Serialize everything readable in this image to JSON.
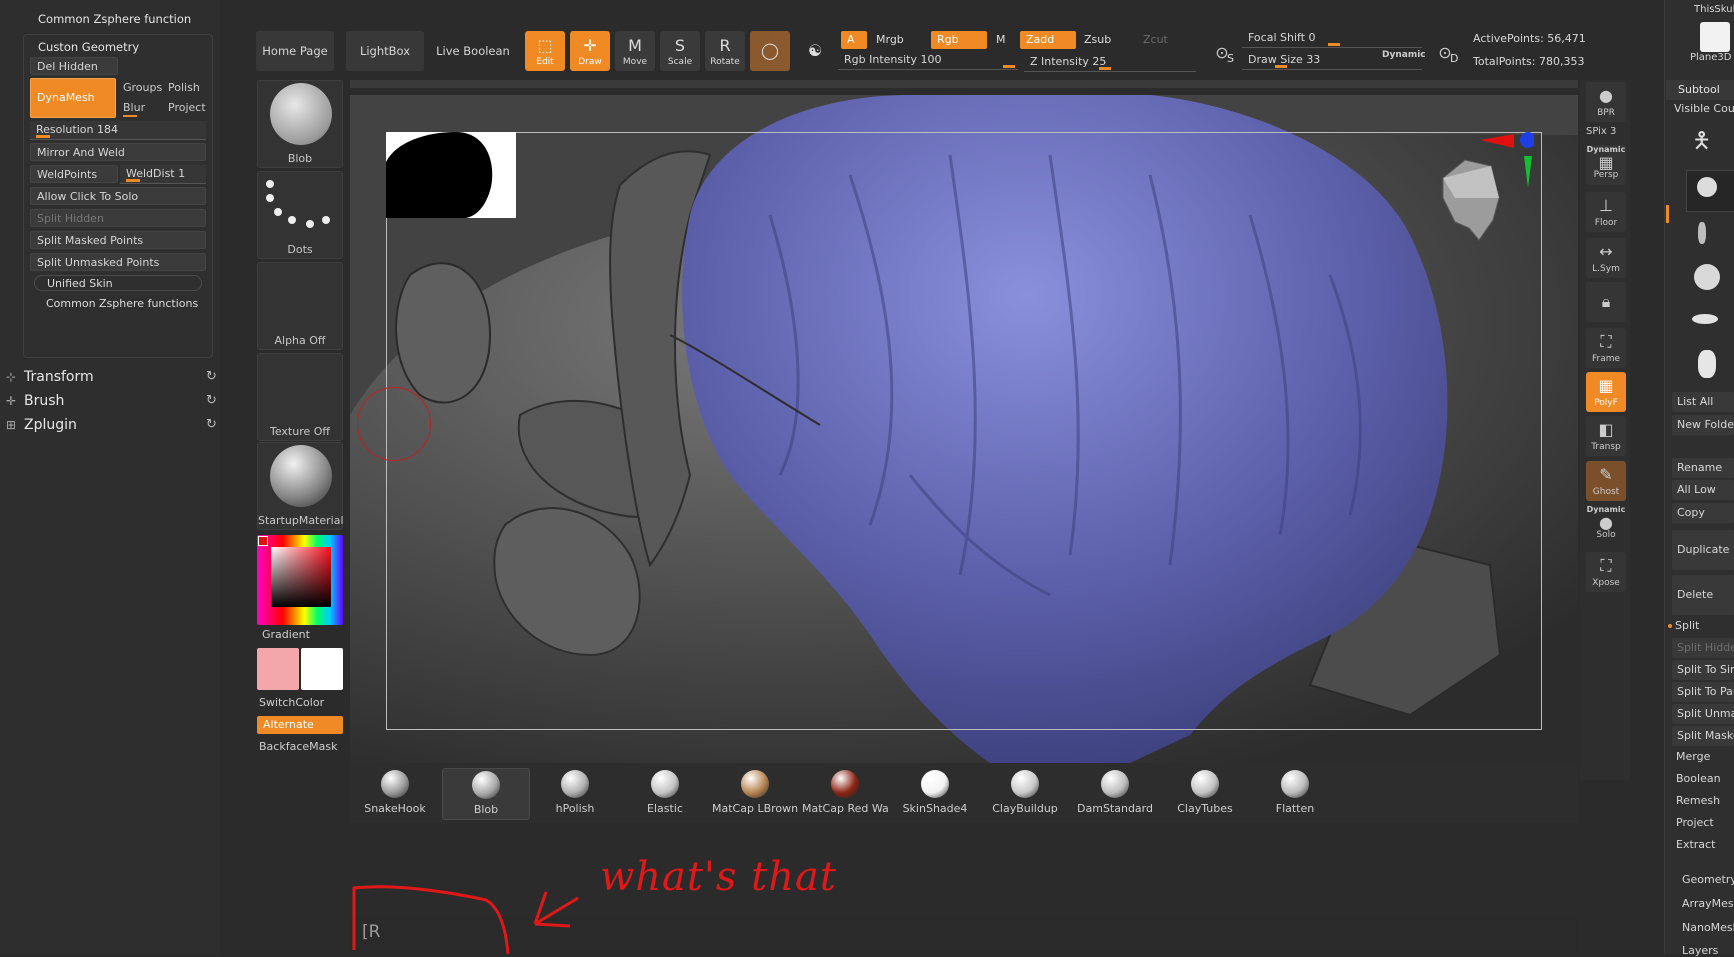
{
  "left_panel": {
    "header": "Common Zsphere function",
    "group_title": "Custon Geometry",
    "del_hidden": "Del Hidden",
    "dynamesh": "DynaMesh",
    "groups": "Groups",
    "polish": "Polish",
    "blur": "Blur",
    "project": "Project",
    "resolution_label": "Resolution",
    "resolution_value": "184",
    "mirror_and_weld": "Mirror And Weld",
    "weldpoints": "WeldPoints",
    "welddist_label": "WeldDist",
    "welddist_value": "1",
    "allow_click_to_solo": "Allow Click To Solo",
    "split_hidden": "Split Hidden",
    "split_masked_points": "Split Masked Points",
    "split_unmasked_points": "Split Unmasked Points",
    "unified_skin": "Unified Skin",
    "common_zsphere_functions": "Common Zsphere functions",
    "menus": [
      {
        "label": "Transform",
        "icon": "transform-icon"
      },
      {
        "label": "Brush",
        "icon": "brush-icon"
      },
      {
        "label": "Zplugin",
        "icon": "zplugin-icon"
      }
    ]
  },
  "shelf": {
    "brush_name": "Blob",
    "stroke_name": "Dots",
    "alpha": "Alpha Off",
    "texture": "Texture Off",
    "material": "StartupMaterial",
    "gradient": "Gradient",
    "switch_color": "SwitchColor",
    "alternate": "Alternate",
    "backface_mask": "BackfaceMask",
    "main_color": "#f4a7ab",
    "secondary_color": "#ffffff"
  },
  "top_bar": {
    "home_page": "Home Page",
    "lightbox": "LightBox",
    "live_boolean": "Live Boolean",
    "tools": [
      {
        "label": "Edit",
        "active": true
      },
      {
        "label": "Draw",
        "active": true
      },
      {
        "label": "Move",
        "active": false
      },
      {
        "label": "Scale",
        "active": false
      },
      {
        "label": "Rotate",
        "active": false
      }
    ],
    "a": "A",
    "mrgb": "Mrgb",
    "rgb": "Rgb",
    "m": "M",
    "zadd": "Zadd",
    "zsub": "Zsub",
    "zcut": "Zcut",
    "rgb_intensity_label": "Rgb Intensity",
    "rgb_intensity_value": "100",
    "z_intensity_label": "Z Intensity",
    "z_intensity_value": "25",
    "focal_shift_label": "Focal Shift",
    "focal_shift_value": "0",
    "draw_size_label": "Draw Size",
    "draw_size_value": "33",
    "dynamic": "Dynamic",
    "active_points_label": "ActivePoints:",
    "active_points_value": "56,471",
    "total_points_label": "TotalPoints:",
    "total_points_value": "780,353",
    "s": "S",
    "d": "D"
  },
  "right_tray": {
    "bpr": "BPR",
    "spix_label": "SPix",
    "spix_value": "3",
    "dynamic": "Dynamic",
    "persp": "Persp",
    "floor": "Floor",
    "lsym": "L.Sym",
    "frame": "Frame",
    "polyf": "PolyF",
    "transp": "Transp",
    "ghost": "Ghost",
    "solo": "Solo",
    "xpose": "Xpose"
  },
  "right_panel": {
    "thumb_top": "ThisSkul",
    "thumb_plane": "Plane3D",
    "subtool": "Subtool",
    "visible_count": "Visible Cou",
    "list_all": "List All",
    "new_folder": "New Folder",
    "rename": "Rename",
    "all_low": "All Low",
    "copy": "Copy",
    "duplicate": "Duplicate",
    "delete": "Delete",
    "split": "Split",
    "split_hidden": "Split Hidden",
    "split_to_similar": "Split To Sim",
    "split_to_parts": "Split To Par",
    "split_unmasked": "Split Unmas",
    "split_masked": "Split Maske",
    "merge": "Merge",
    "boolean": "Boolean",
    "remesh": "Remesh",
    "project": "Project",
    "extract": "Extract",
    "geometry": "Geometry",
    "arraymesh": "ArrayMesh",
    "nanomesh": "NanoMesh",
    "layers": "Layers"
  },
  "brushes": [
    {
      "label": "SnakeHook",
      "color": "#9a9a9a"
    },
    {
      "label": "Blob",
      "color": "#a8a8a8"
    },
    {
      "label": "hPolish",
      "color": "#b0b0b0"
    },
    {
      "label": "Elastic",
      "color": "#c4c4c4"
    },
    {
      "label": "MatCap LBrownC",
      "color": "#b58352"
    },
    {
      "label": "MatCap Red Wax",
      "color": "#8a2412"
    },
    {
      "label": "SkinShade4",
      "color": "#f2f2f2"
    },
    {
      "label": "ClayBuildup",
      "color": "#c9c9c9"
    },
    {
      "label": "DamStandard",
      "color": "#bdbdbd"
    },
    {
      "label": "ClayTubes",
      "color": "#c2c2c2"
    },
    {
      "label": "Flatten",
      "color": "#bababa"
    }
  ],
  "annotation": {
    "note": "what's that",
    "hotkey_text": "[R"
  }
}
